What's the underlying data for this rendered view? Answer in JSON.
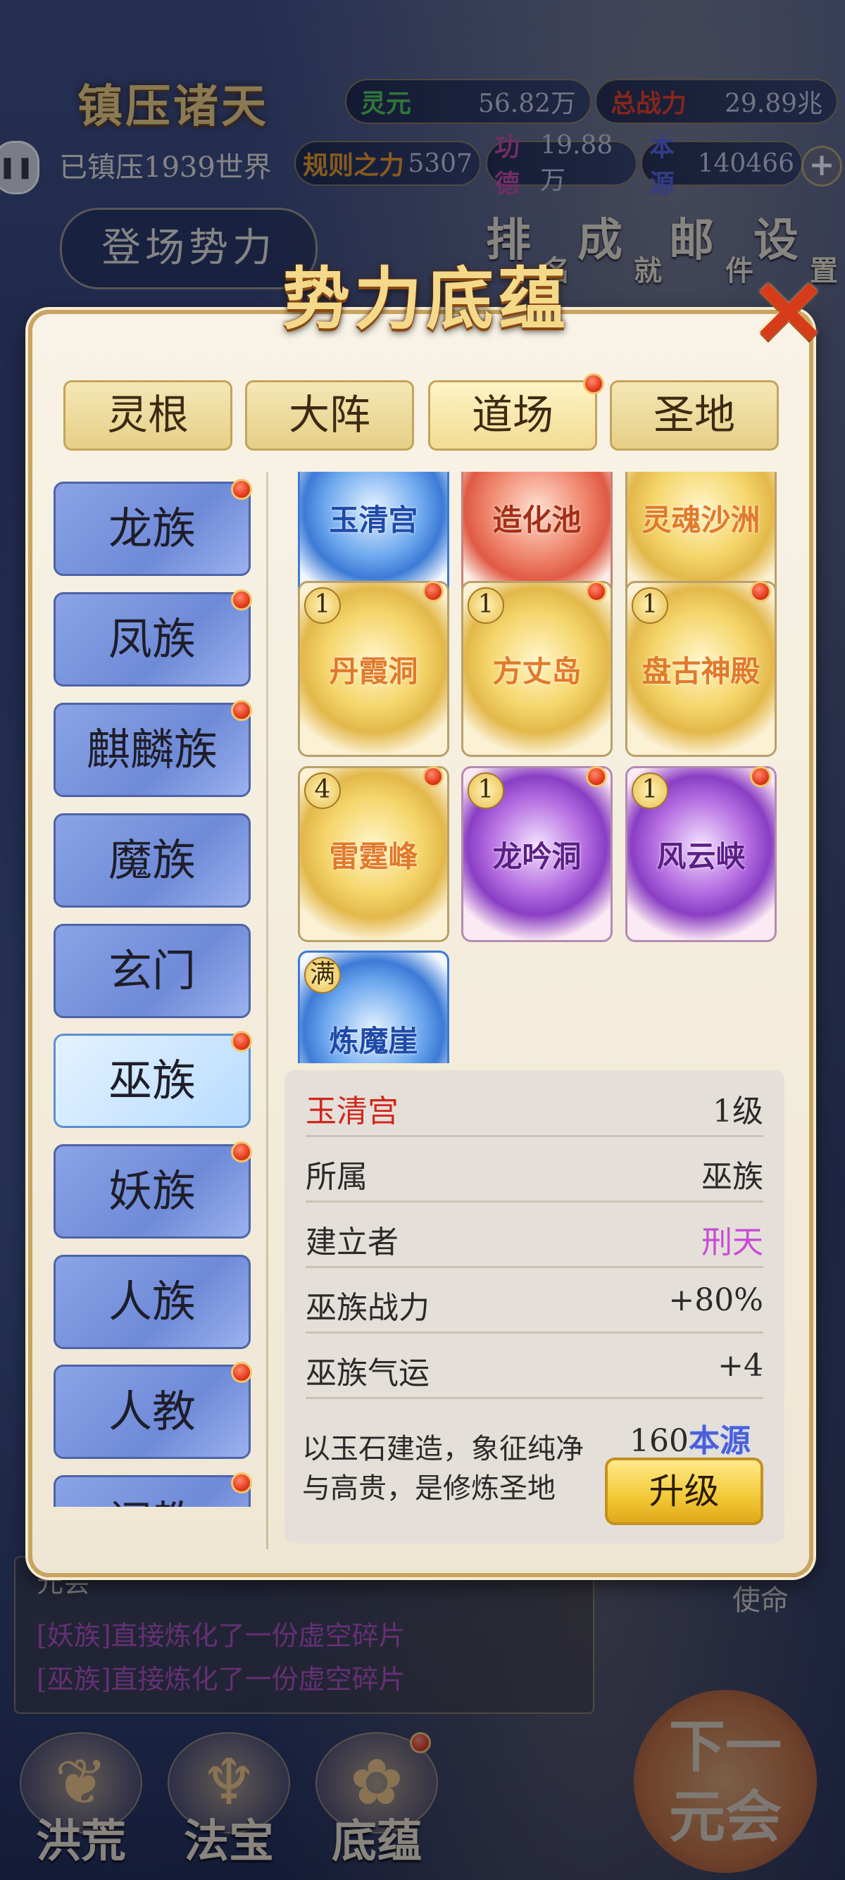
{
  "hud": {
    "title": "镇压诸天",
    "world_status": "已镇压1939世界",
    "stats": [
      {
        "label": "灵元",
        "value": "56.82万",
        "color": "#4ec94a"
      },
      {
        "label": "总战力",
        "value": "29.89兆",
        "color": "#e53a1a"
      },
      {
        "label": "规则之力",
        "value": "5307",
        "color": "#e99a1d"
      },
      {
        "label": "功德",
        "value": "19.88万",
        "color": "#c24a9a"
      },
      {
        "label": "本源",
        "value": "140466",
        "color": "#5561d8"
      }
    ],
    "debut_button": "登场势力",
    "nav": [
      {
        "main": "排",
        "sub": "名"
      },
      {
        "main": "成",
        "sub": "就"
      },
      {
        "main": "邮",
        "sub": "件"
      },
      {
        "main": "设",
        "sub": "置"
      }
    ]
  },
  "modal": {
    "title": "势力底蕴",
    "tabs": [
      "灵根",
      "大阵",
      "道场",
      "圣地"
    ],
    "active_tab": "道场",
    "races": [
      "龙族",
      "凤族",
      "麒麟族",
      "魔族",
      "玄门",
      "巫族",
      "妖族",
      "人族",
      "人教",
      "阐教"
    ],
    "active_race": "巫族",
    "cards": [
      {
        "name": "玉清宫",
        "level": "",
        "style": "blue"
      },
      {
        "name": "造化池",
        "level": "",
        "style": "red"
      },
      {
        "name": "灵魂沙洲",
        "level": "",
        "style": "gold"
      },
      {
        "name": "丹霞洞",
        "level": "1",
        "style": "gold"
      },
      {
        "name": "方丈岛",
        "level": "1",
        "style": "gold"
      },
      {
        "name": "盘古神殿",
        "level": "1",
        "style": "gold"
      },
      {
        "name": "雷霆峰",
        "level": "4",
        "style": "gold"
      },
      {
        "name": "龙吟洞",
        "level": "1",
        "style": "purple"
      },
      {
        "name": "风云峡",
        "level": "1",
        "style": "purple"
      },
      {
        "name": "炼魔崖",
        "level": "满",
        "style": "blue"
      }
    ],
    "detail": {
      "name": "玉清宫",
      "level": "1级",
      "rows": [
        {
          "k": "所属",
          "v": "巫族"
        },
        {
          "k": "建立者",
          "v": "刑天"
        },
        {
          "k": "巫族战力",
          "v": "+80%"
        },
        {
          "k": "巫族气运",
          "v": "+4"
        }
      ],
      "description": "以玉石建造，象征纯净与高贵，是修炼圣地",
      "cost_amount": "160",
      "cost_unit": "本源",
      "upgrade_label": "升级"
    }
  },
  "log": {
    "header": "元会",
    "lines": [
      "[妖族]直接炼化了一份虚空碎片",
      "[巫族]直接炼化了一份虚空碎片"
    ]
  },
  "mission_label": "使命",
  "next_button": {
    "line1": "下一",
    "line2": "元会"
  },
  "bottom_tabs": [
    {
      "label": "洪荒",
      "icon": "tree-icon"
    },
    {
      "label": "法宝",
      "icon": "treasure-icon"
    },
    {
      "label": "底蕴",
      "icon": "lotus-icon"
    }
  ],
  "colors": {
    "detail_name": "#d2261d",
    "founder": "#c94ad6",
    "panel_border": "#c7a561"
  }
}
